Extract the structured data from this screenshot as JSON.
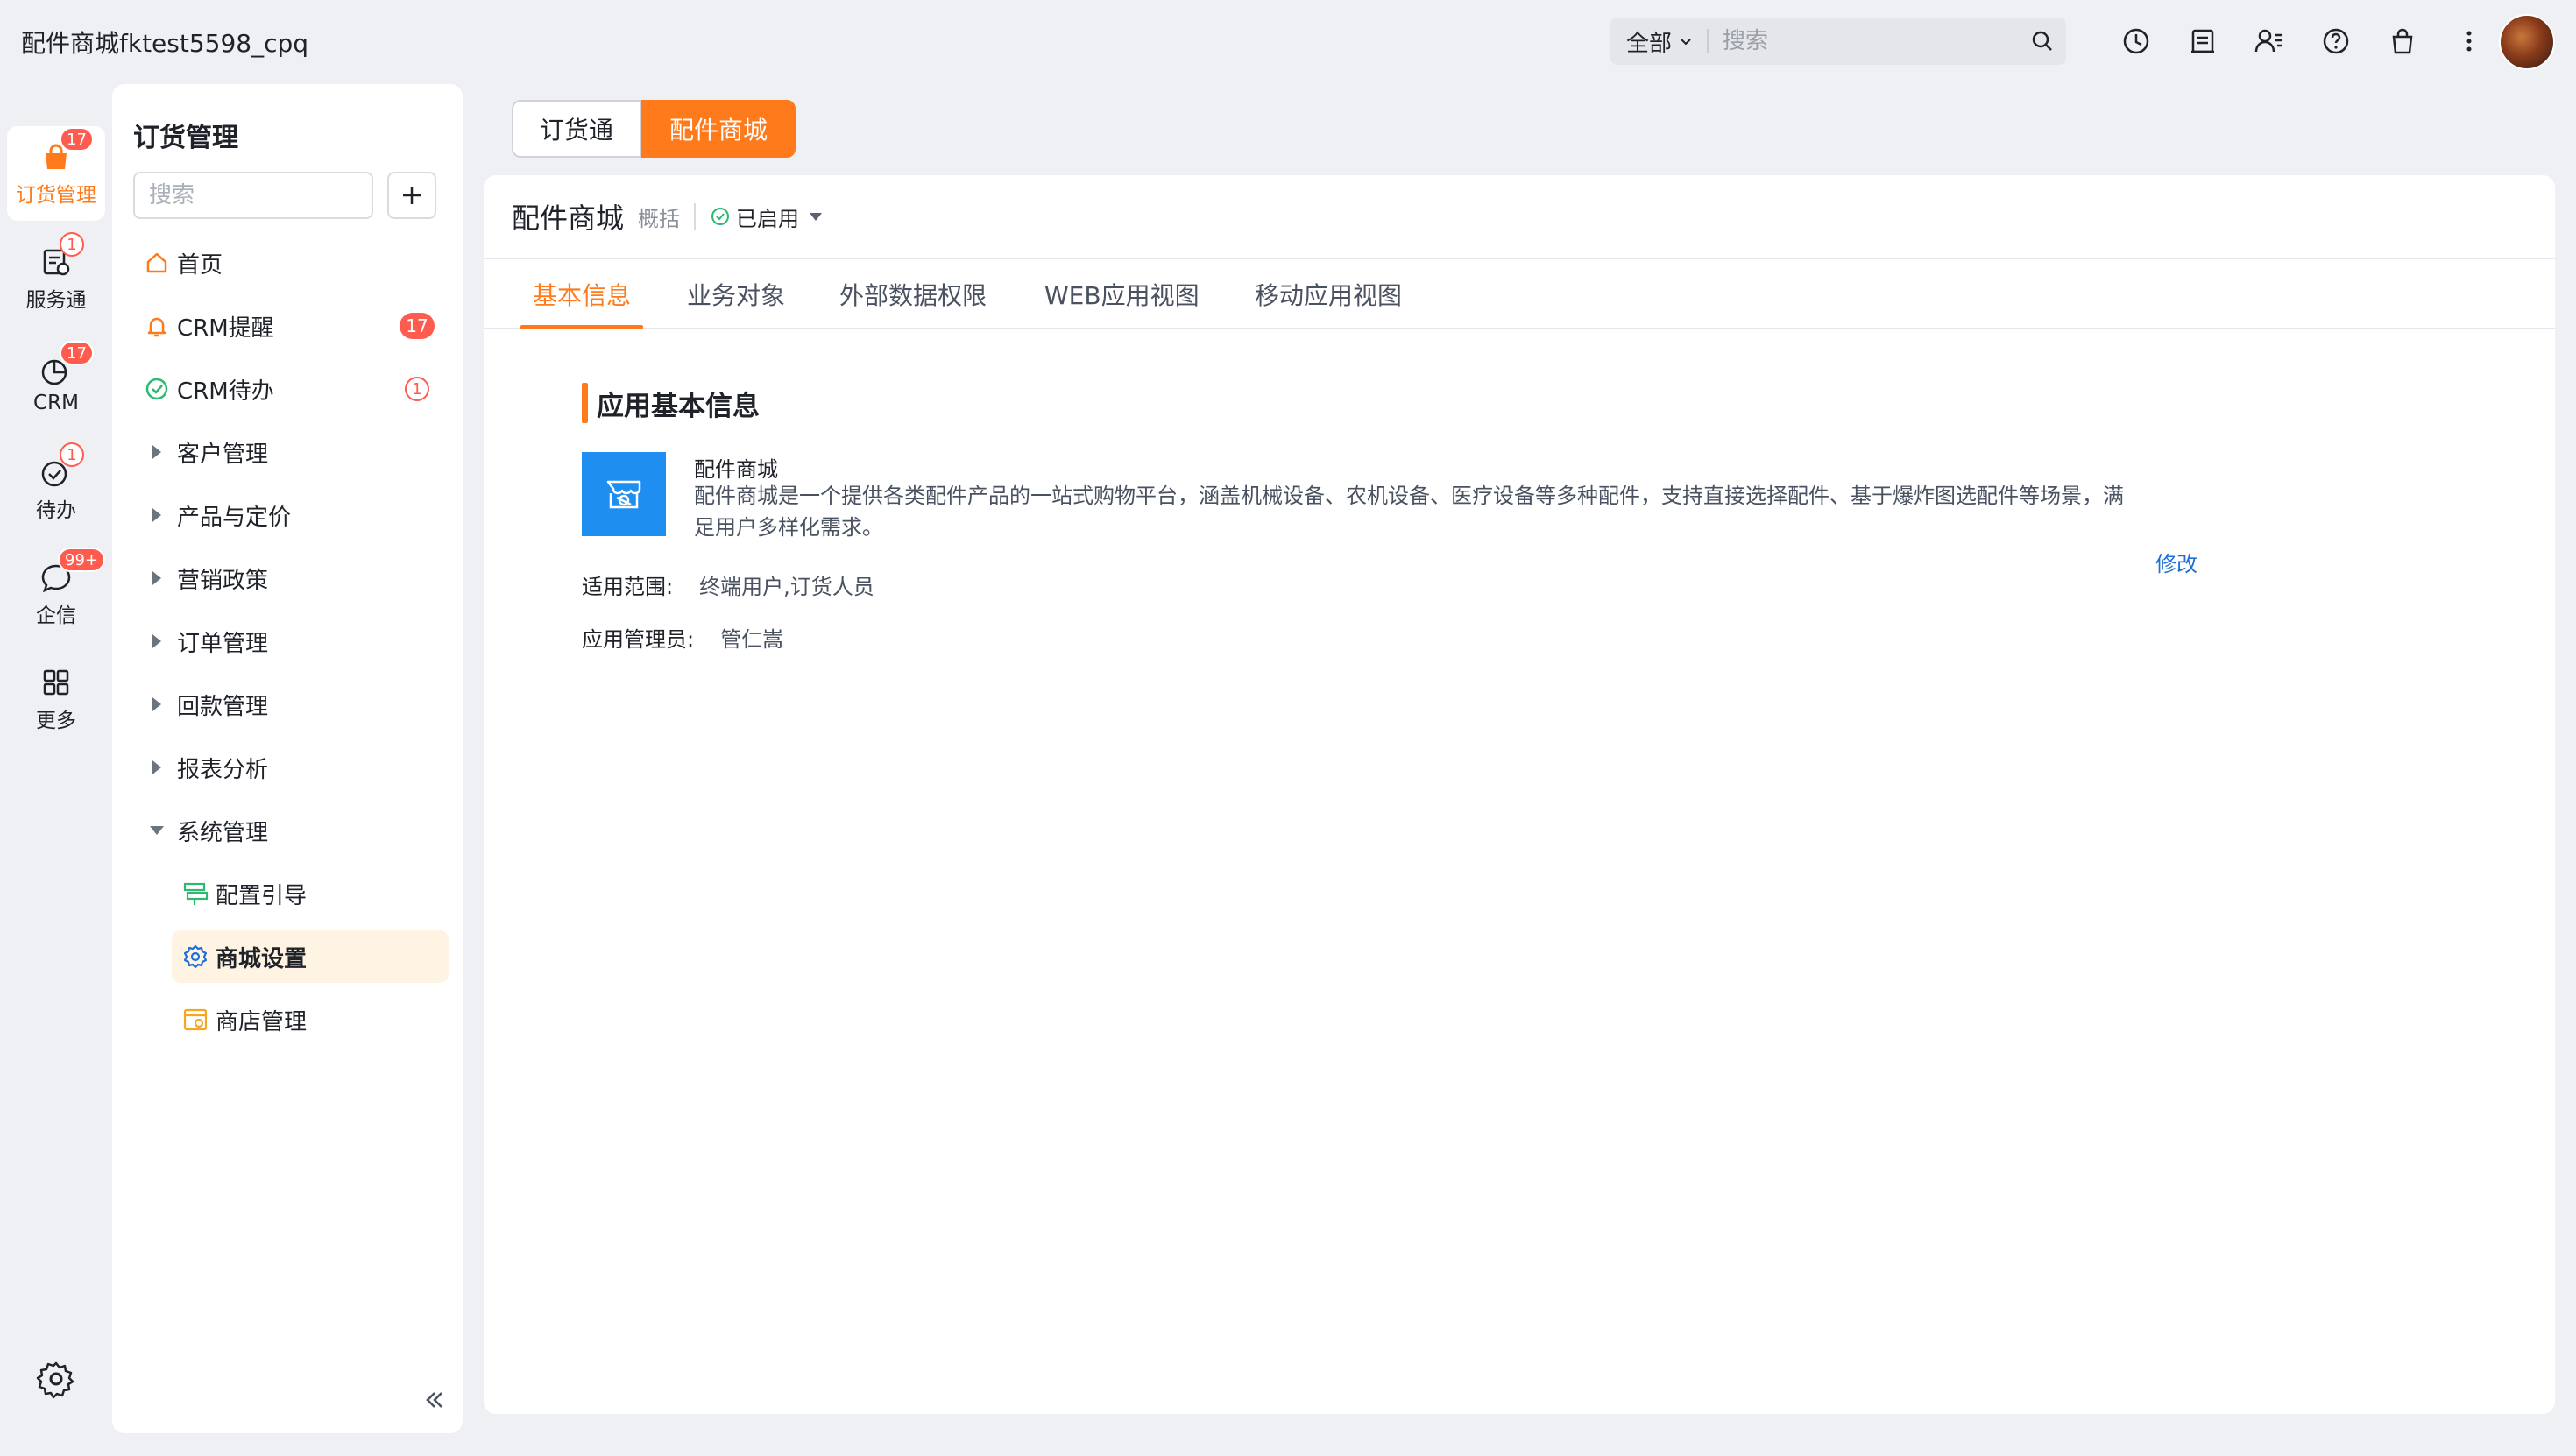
{
  "app_title": "配件商城fktest5598_cpq",
  "search": {
    "scope": "全部",
    "placeholder": "搜索"
  },
  "rail": {
    "items": [
      {
        "label": "订货管理",
        "badge": "17",
        "active": true
      },
      {
        "label": "服务通",
        "badge": "1"
      },
      {
        "label": "CRM",
        "badge": "17"
      },
      {
        "label": "待办",
        "badge": "1"
      },
      {
        "label": "企信",
        "badge": "99+"
      },
      {
        "label": "更多"
      }
    ]
  },
  "nav": {
    "title": "订货管理",
    "search_placeholder": "搜索",
    "items": [
      {
        "label": "首页"
      },
      {
        "label": "CRM提醒",
        "badge": "17"
      },
      {
        "label": "CRM待办",
        "badge": "1"
      },
      {
        "label": "客户管理"
      },
      {
        "label": "产品与定价"
      },
      {
        "label": "营销政策"
      },
      {
        "label": "订单管理"
      },
      {
        "label": "回款管理"
      },
      {
        "label": "报表分析"
      },
      {
        "label": "系统管理"
      },
      {
        "label": "配置引导"
      },
      {
        "label": "商城设置"
      },
      {
        "label": "商店管理"
      }
    ]
  },
  "app_tabs": [
    {
      "label": "订货通"
    },
    {
      "label": "配件商城",
      "active": true
    }
  ],
  "main": {
    "title": "配件商城",
    "subtitle": "概括",
    "status": "已启用",
    "tabs": [
      {
        "label": "基本信息",
        "active": true
      },
      {
        "label": "业务对象"
      },
      {
        "label": "外部数据权限"
      },
      {
        "label": "WEB应用视图"
      },
      {
        "label": "移动应用视图"
      }
    ],
    "section_title": "应用基本信息",
    "app_name": "配件商城",
    "app_desc": "配件商城是一个提供各类配件产品的一站式购物平台，涵盖机械设备、农机设备、医疗设备等多种配件，支持直接选择配件、基于爆炸图选配件等场景，满足用户多样化需求。",
    "edit_label": "修改",
    "scope_label": "适用范围:",
    "scope_value": "终端用户,订货人员",
    "admin_label": "应用管理员:",
    "admin_value": "管仁嵩"
  },
  "colors": {
    "accent": "#ff7a1a",
    "badge": "#ff5b4f",
    "link": "#1f6fd6",
    "logo": "#1f8ef1"
  }
}
